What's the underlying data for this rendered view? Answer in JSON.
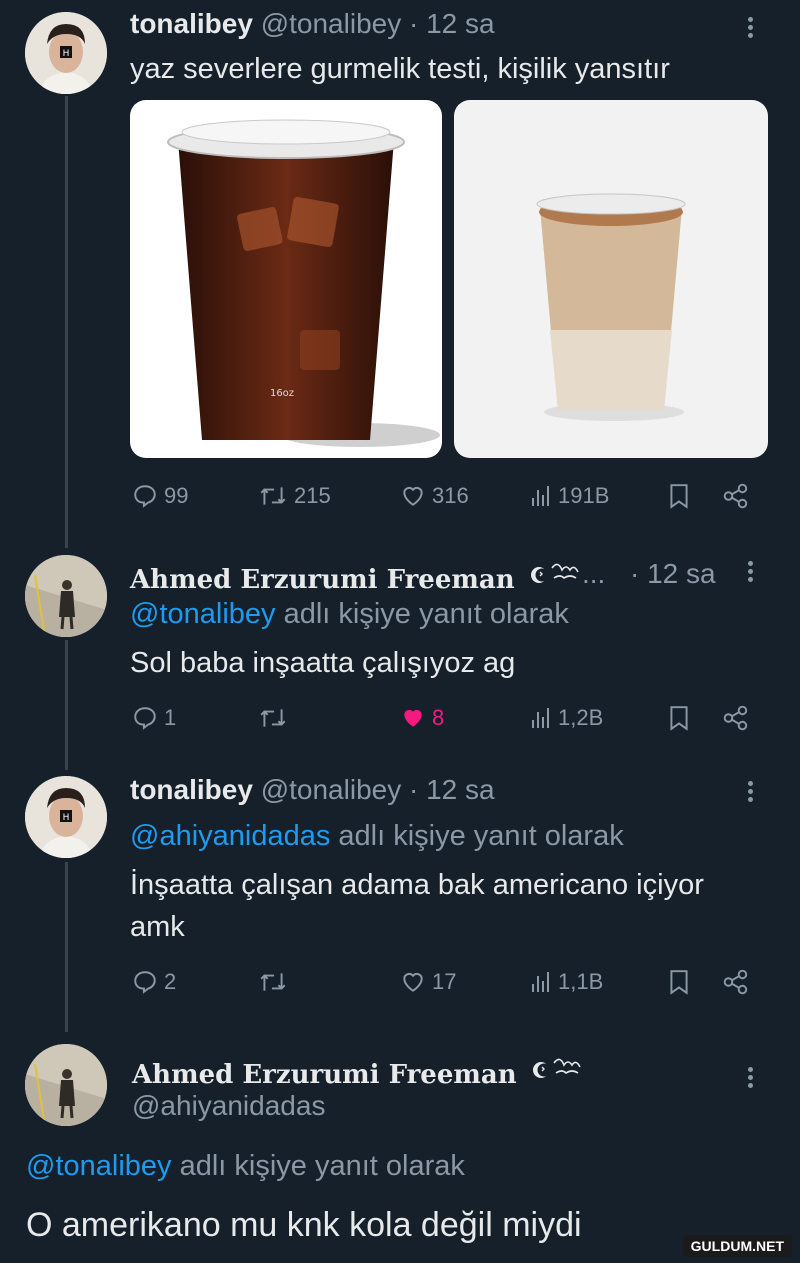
{
  "tweet1": {
    "name": "tonalibey",
    "handle": "@tonalibey",
    "time": "· 12 sa",
    "text": "yaz severlere gurmelik testi, kişilik yansıtır",
    "media_label": "16oz",
    "actions": {
      "replies": "99",
      "retweets": "215",
      "likes": "316",
      "views": "191B"
    }
  },
  "tweet2": {
    "name": "Ahmed Erzurumi Freeman",
    "ellipsis": "...",
    "time": "· 12 sa",
    "reply_handle": "@tonalibey",
    "reply_suffix": "adlı kişiye yanıt olarak",
    "text": "Sol baba inşaatta çalışıyoz ag",
    "actions": {
      "replies": "1",
      "retweets": "",
      "likes": "8",
      "views": "1,2B"
    }
  },
  "tweet3": {
    "name": "tonalibey",
    "handle": "@tonalibey",
    "time": "· 12 sa",
    "reply_handle": "@ahiyanidadas",
    "reply_suffix": "adlı kişiye yanıt olarak",
    "text_line1": "İnşaatta çalışan adama bak americano içiyor",
    "text_line2": "amk",
    "actions": {
      "replies": "2",
      "retweets": "",
      "likes": "17",
      "views": "1,1B"
    }
  },
  "tweet4": {
    "name": "Ahmed Erzurumi Freeman",
    "handle": "@ahiyanidadas",
    "reply_handle": "@tonalibey",
    "reply_suffix": "adlı kişiye yanıt olarak",
    "text": "O amerikano mu knk kola değil miydi"
  },
  "watermark": "GULDUM.NET",
  "colors": {
    "background": "#15202b",
    "link": "#1d9bf0",
    "muted": "#8b98a5",
    "like_active": "#f91880"
  }
}
